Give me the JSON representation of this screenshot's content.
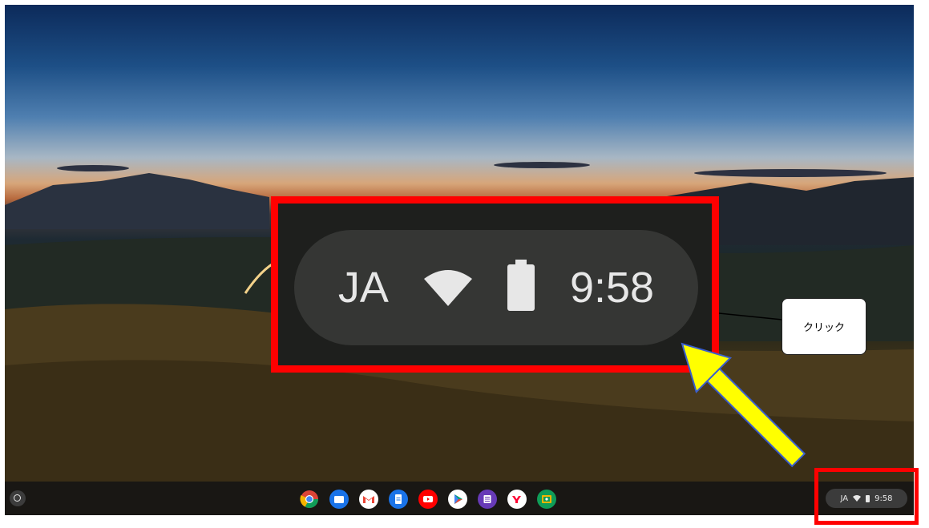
{
  "tray": {
    "ime": "JA",
    "time": "9:58"
  },
  "zoom": {
    "ime": "JA",
    "time": "9:58"
  },
  "callout": {
    "text": "クリック"
  },
  "colors": {
    "highlight_red": "#ff0000",
    "arrow_yellow": "#ffff00",
    "shelf": "#141414"
  },
  "shelf_apps": [
    {
      "name": "chrome-icon"
    },
    {
      "name": "files-icon"
    },
    {
      "name": "gmail-icon"
    },
    {
      "name": "docs-icon"
    },
    {
      "name": "youtube-icon"
    },
    {
      "name": "play-store-icon"
    },
    {
      "name": "forms-icon"
    },
    {
      "name": "yahoo-icon"
    },
    {
      "name": "classroom-icon"
    }
  ]
}
